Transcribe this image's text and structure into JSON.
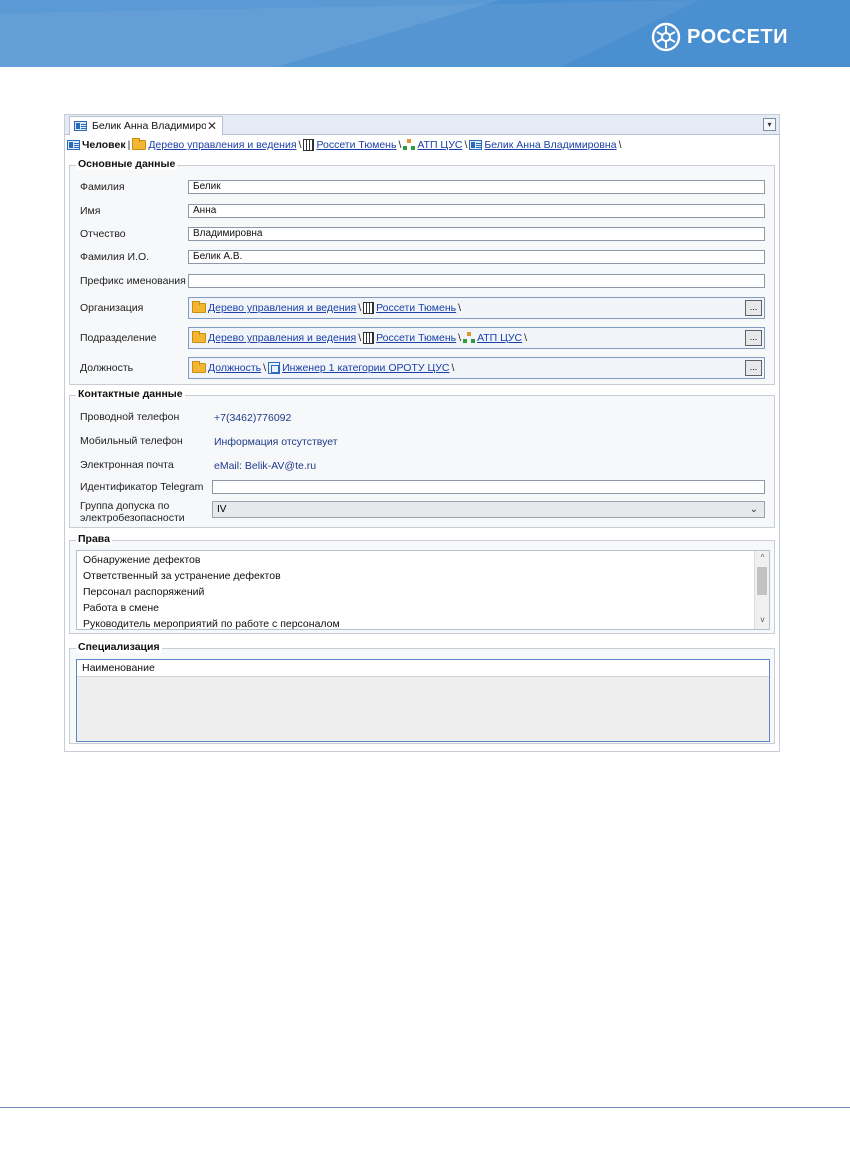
{
  "brand": {
    "name": "РОССЕТИ",
    "color": "#4a8fd0"
  },
  "tab": {
    "title": "Белик Анна Владимиро...",
    "close": "✕",
    "dropdown": "▾"
  },
  "breadcrumb": {
    "root": "Человек",
    "items": [
      "Дерево управления и ведения",
      "Россети Тюмень",
      "АТП ЦУС",
      "Белик Анна Владимировна"
    ],
    "separator": "\\"
  },
  "main_section": {
    "title": "Основные данные",
    "fields": {
      "last_name": {
        "label": "Фамилия",
        "value": "Белик"
      },
      "first_name": {
        "label": "Имя",
        "value": "Анна"
      },
      "patronymic": {
        "label": "Отчество",
        "value": "Владимировна"
      },
      "short_name": {
        "label": "Фамилия И.О.",
        "value": "Белик А.В."
      },
      "prefix": {
        "label": "Префикс именования",
        "value": ""
      }
    },
    "organization": {
      "label": "Организация",
      "path": [
        "Дерево управления и ведения",
        "Россети Тюмень"
      ]
    },
    "department": {
      "label": "Подразделение",
      "path": [
        "Дерево управления и ведения",
        "Россети Тюмень",
        "АТП ЦУС"
      ]
    },
    "position": {
      "label": "Должность",
      "path": [
        "Должность",
        "Инженер 1 категории ОРОТУ ЦУС"
      ]
    },
    "browse_label": "..."
  },
  "contact_section": {
    "title": "Контактные данные",
    "landline": {
      "label": "Проводной телефон",
      "value": "+7(3462)776092"
    },
    "mobile": {
      "label": "Мобильный телефон",
      "value": "Информация отсутствует"
    },
    "email": {
      "label": "Электронная почта",
      "value": "eMail: Belik-AV@te.ru"
    },
    "telegram": {
      "label": "Идентификатор Telegram",
      "value": ""
    },
    "safety_group": {
      "label_line1": "Группа допуска по",
      "label_line2": "электробезопасности",
      "value": "IV"
    }
  },
  "rights_section": {
    "title": "Права",
    "items": [
      "Обнаружение дефектов",
      "Ответственный за устранение дефектов",
      "Персонал распоряжений",
      "Работа в смене",
      "Руководитель мероприятий по работе с персоналом"
    ]
  },
  "specialization_section": {
    "title": "Специализация",
    "column": "Наименование"
  }
}
